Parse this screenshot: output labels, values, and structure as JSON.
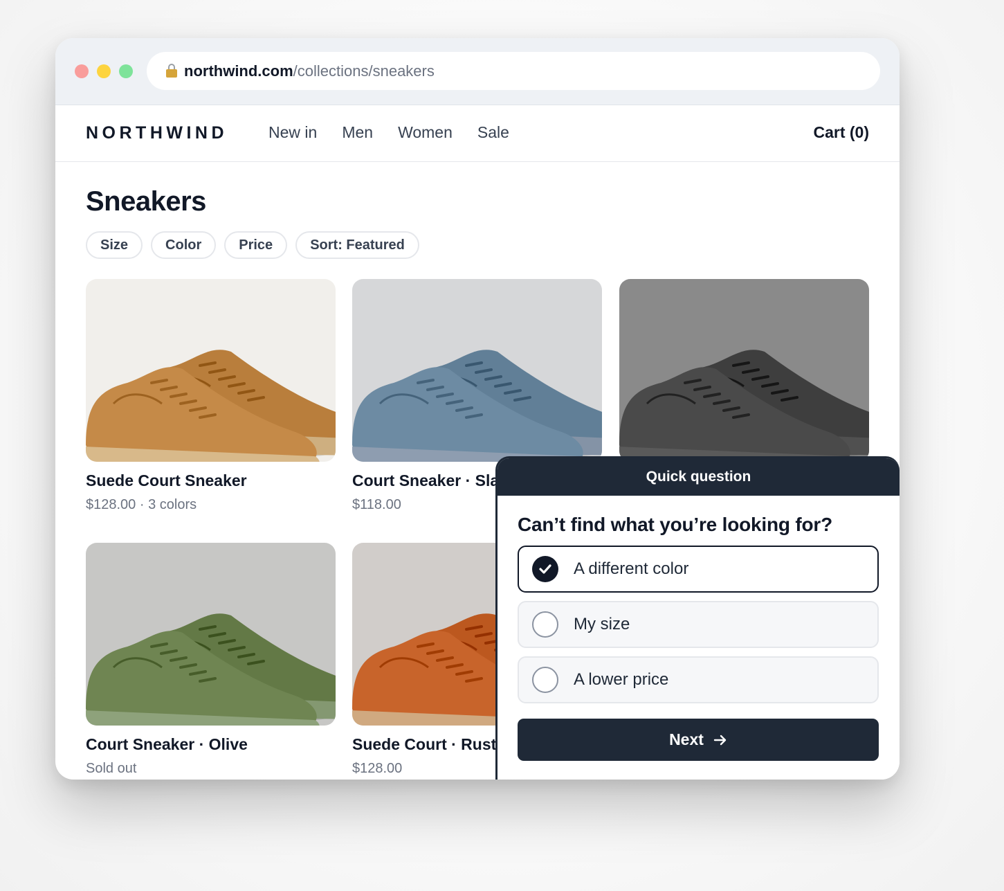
{
  "browser": {
    "url_domain": "northwind.com",
    "url_path": "/collections/sneakers"
  },
  "header": {
    "logo": "NORTHWIND",
    "nav": [
      "New in",
      "Men",
      "Women",
      "Sale"
    ],
    "cart": "Cart (0)"
  },
  "page": {
    "title": "Sneakers",
    "filters": [
      "Size",
      "Color",
      "Price",
      "Sort: Featured"
    ]
  },
  "products": [
    {
      "name": "Suede Court Sneaker",
      "meta": "$128.00 · 3 colors",
      "bg": "#f1efeb",
      "shoe": "#c58a48",
      "sole": "#d8b98a"
    },
    {
      "name": "Court Sneaker · Sla",
      "meta": "$118.00",
      "bg": "#d6d7d9",
      "shoe": "#6d8ba3",
      "sole": "#8e9db0"
    },
    {
      "name": "",
      "meta": "",
      "bg": "#8a8a8a",
      "shoe": "#4a4a4a",
      "sole": "#5a5a5a"
    },
    {
      "name": "Court Sneaker · Olive",
      "meta": "Sold out",
      "bg": "#c7c7c5",
      "shoe": "#6f8552",
      "sole": "#8ea27b"
    },
    {
      "name": "Suede Court · Rust",
      "meta": "$128.00",
      "bg": "#d1cdca",
      "shoe": "#c8642b",
      "sole": "#d0a980"
    }
  ],
  "popup": {
    "header": "Quick question",
    "question": "Can’t find what you’re looking for?",
    "options": [
      {
        "label": "A different color",
        "selected": true
      },
      {
        "label": "My size",
        "selected": false
      },
      {
        "label": "A lower price",
        "selected": false
      }
    ],
    "next_label": "Next",
    "next_icon": "arrow-right-icon"
  }
}
